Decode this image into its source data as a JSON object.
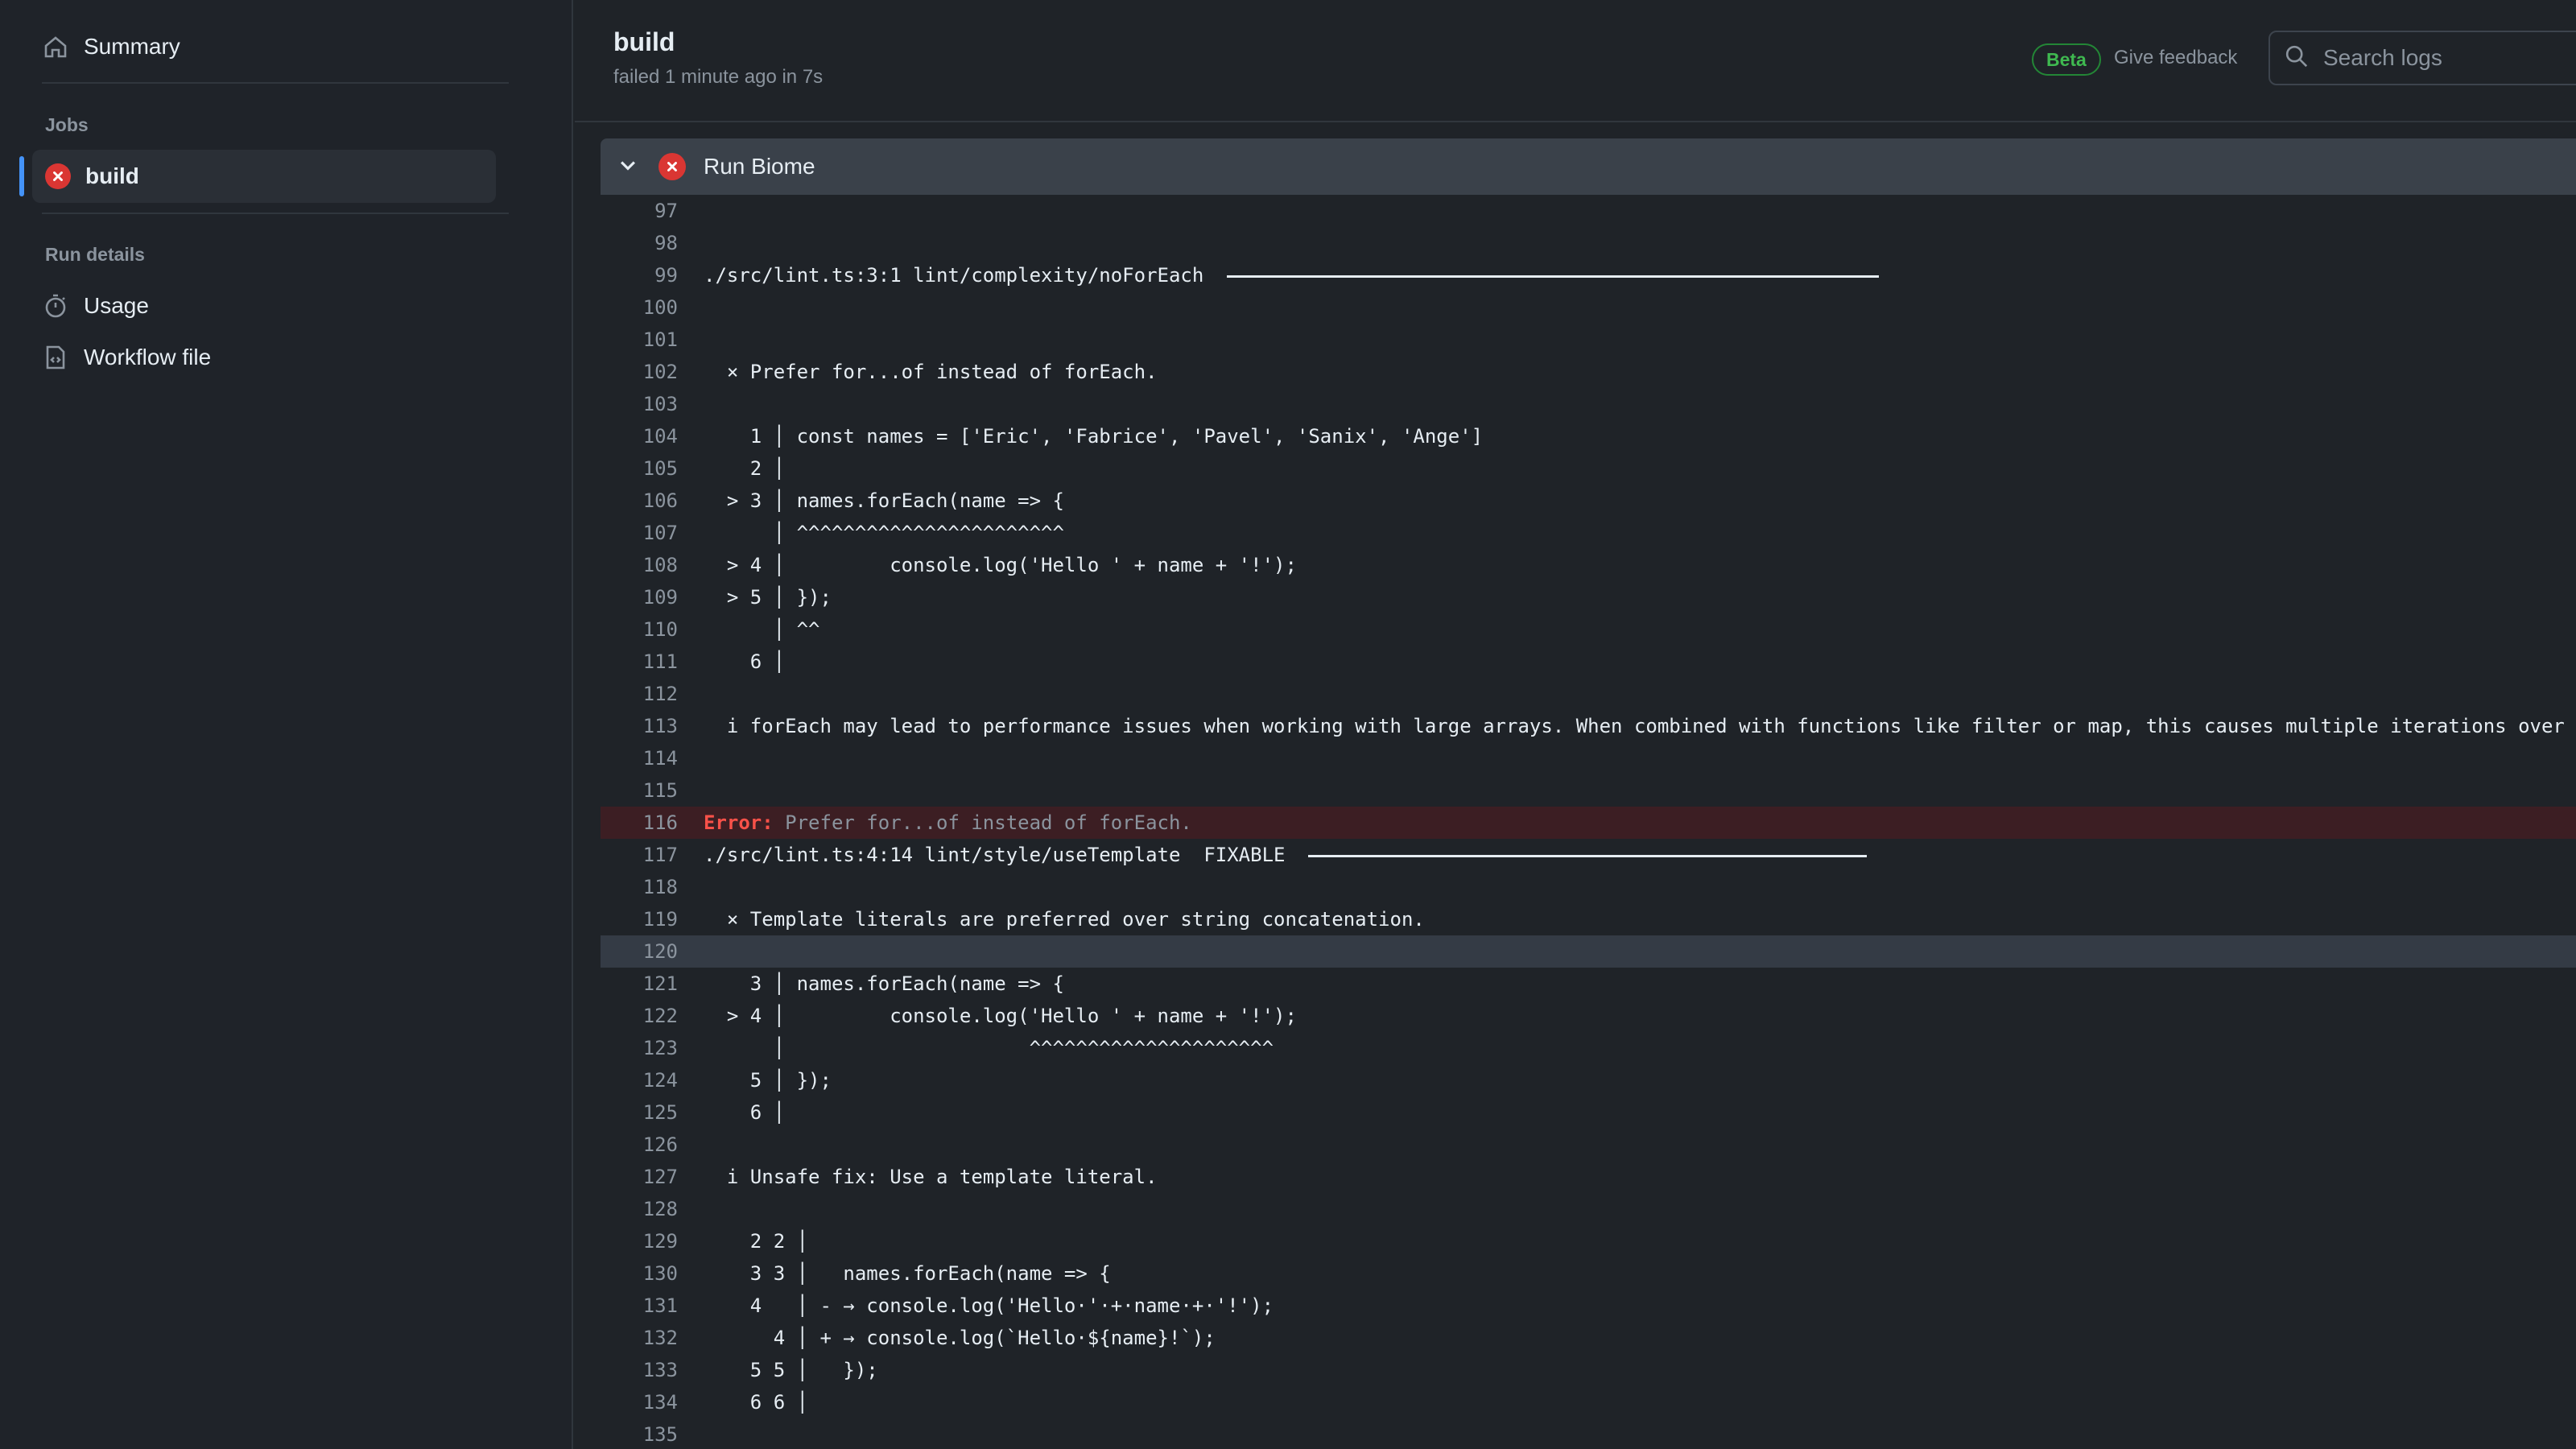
{
  "sidebar": {
    "summary_label": "Summary",
    "jobs_heading": "Jobs",
    "job": {
      "label": "build",
      "status": "failed"
    },
    "run_details_heading": "Run details",
    "usage_label": "Usage",
    "workflow_label": "Workflow file"
  },
  "header": {
    "title": "build",
    "subtitle": "failed 1 minute ago in 7s",
    "beta_badge": "Beta",
    "feedback_link": "Give feedback",
    "search_placeholder": "Search logs"
  },
  "step": {
    "name": "Run Biome",
    "status": "failed"
  },
  "colors": {
    "error": "#da3633",
    "accent": "#4493f8",
    "beta": "#3fb950"
  },
  "log": [
    {
      "n": "97",
      "t": ""
    },
    {
      "n": "98",
      "t": ""
    },
    {
      "n": "99",
      "t": "./src/lint.ts:3:1 lint/complexity/noForEach "
    },
    {
      "n": "100",
      "t": ""
    },
    {
      "n": "101",
      "t": ""
    },
    {
      "n": "102",
      "t": "  × Prefer for...of instead of forEach."
    },
    {
      "n": "103",
      "t": ""
    },
    {
      "n": "104",
      "t": "    1 │ const names = ['Eric', 'Fabrice', 'Pavel', 'Sanix', 'Ange']"
    },
    {
      "n": "105",
      "t": "    2 │"
    },
    {
      "n": "106",
      "t": "  > 3 │ names.forEach(name => {"
    },
    {
      "n": "107",
      "t": "      │ ^^^^^^^^^^^^^^^^^^^^^^^"
    },
    {
      "n": "108",
      "t": "  > 4 │         console.log('Hello ' + name + '!');"
    },
    {
      "n": "109",
      "t": "  > 5 │ });"
    },
    {
      "n": "110",
      "t": "      │ ^^"
    },
    {
      "n": "111",
      "t": "    6 │"
    },
    {
      "n": "112",
      "t": ""
    },
    {
      "n": "113",
      "t": "  i forEach may lead to performance issues when working with large arrays. When combined with functions like filter or map, this causes multiple iterations over"
    },
    {
      "n": "114",
      "t": ""
    },
    {
      "n": "115",
      "t": ""
    },
    {
      "n": "116",
      "t": "",
      "error_label": "Error:",
      "error_msg": " Prefer for...of instead of forEach."
    },
    {
      "n": "117",
      "t": "./src/lint.ts:4:14 lint/style/useTemplate  FIXABLE "
    },
    {
      "n": "118",
      "t": ""
    },
    {
      "n": "119",
      "t": "  × Template literals are preferred over string concatenation."
    },
    {
      "n": "120",
      "t": ""
    },
    {
      "n": "121",
      "t": "    3 │ names.forEach(name => {"
    },
    {
      "n": "122",
      "t": "  > 4 │         console.log('Hello ' + name + '!');"
    },
    {
      "n": "123",
      "t": "      │                     ^^^^^^^^^^^^^^^^^^^^^"
    },
    {
      "n": "124",
      "t": "    5 │ });"
    },
    {
      "n": "125",
      "t": "    6 │"
    },
    {
      "n": "126",
      "t": ""
    },
    {
      "n": "127",
      "t": "  i Unsafe fix: Use a template literal."
    },
    {
      "n": "128",
      "t": ""
    },
    {
      "n": "129",
      "t": "    2 2 │"
    },
    {
      "n": "130",
      "t": "    3 3 │   names.forEach(name => {"
    },
    {
      "n": "131",
      "t": "    4   │ - → console.log('Hello·'·+·name·+·'!');"
    },
    {
      "n": "132",
      "t": "      4 │ + → console.log(`Hello·${name}!`);"
    },
    {
      "n": "133",
      "t": "    5 5 │   });"
    },
    {
      "n": "134",
      "t": "    6 6 │"
    },
    {
      "n": "135",
      "t": ""
    }
  ]
}
